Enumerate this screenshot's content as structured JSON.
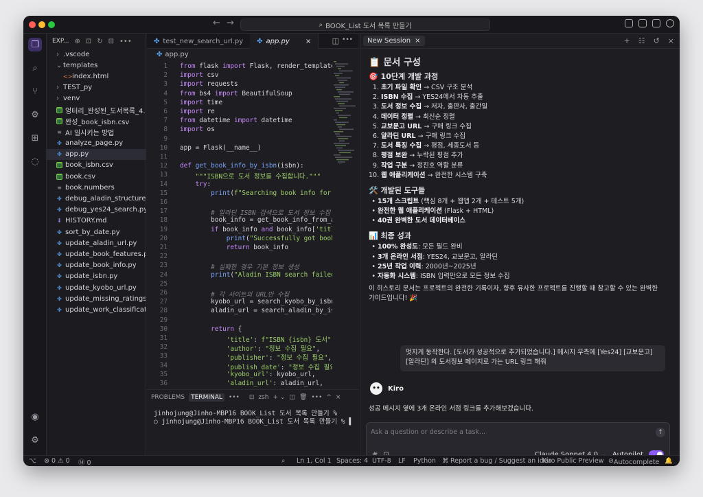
{
  "window": {
    "search": "BOOK_List 도서 목록 만들기"
  },
  "explorer": {
    "title": "EXP...",
    "items": [
      {
        "label": ".vscode",
        "type": "folder",
        "chev": "›",
        "indent": 0
      },
      {
        "label": "templates",
        "type": "folder",
        "chev": "⌄",
        "indent": 0
      },
      {
        "label": "index.html",
        "type": "html",
        "chev": "",
        "indent": 1
      },
      {
        "label": "TEST_py",
        "type": "folder",
        "chev": "›",
        "indent": 0
      },
      {
        "label": "venv",
        "type": "folder",
        "chev": "›",
        "indent": 0
      },
      {
        "label": "엉터리_완성된_도서목록_4...",
        "type": "sheet",
        "chev": "",
        "indent": 0
      },
      {
        "label": "완성_book_isbn.csv",
        "type": "sheet",
        "chev": "",
        "indent": 0
      },
      {
        "label": "AI 일시키는 방법",
        "type": "text",
        "chev": "",
        "indent": 0
      },
      {
        "label": "analyze_page.py",
        "type": "py",
        "chev": "",
        "indent": 0
      },
      {
        "label": "app.py",
        "type": "py",
        "chev": "",
        "indent": 0,
        "selected": true
      },
      {
        "label": "book_isbn.csv",
        "type": "sheet",
        "chev": "",
        "indent": 0
      },
      {
        "label": "book.csv",
        "type": "sheet",
        "chev": "",
        "indent": 0
      },
      {
        "label": "book.numbers",
        "type": "text",
        "chev": "",
        "indent": 0
      },
      {
        "label": "debug_aladin_structure...",
        "type": "py",
        "chev": "",
        "indent": 0
      },
      {
        "label": "debug_yes24_search.py",
        "type": "py",
        "chev": "",
        "indent": 0
      },
      {
        "label": "HISTORY.md",
        "type": "md",
        "chev": "",
        "indent": 0
      },
      {
        "label": "sort_by_date.py",
        "type": "py",
        "chev": "",
        "indent": 0
      },
      {
        "label": "update_aladin_url.py",
        "type": "py",
        "chev": "",
        "indent": 0
      },
      {
        "label": "update_book_features.py",
        "type": "py",
        "chev": "",
        "indent": 0
      },
      {
        "label": "update_book_info.py",
        "type": "py",
        "chev": "",
        "indent": 0
      },
      {
        "label": "update_isbn.py",
        "type": "py",
        "chev": "",
        "indent": 0
      },
      {
        "label": "update_kyobo_url.py",
        "type": "py",
        "chev": "",
        "indent": 0
      },
      {
        "label": "update_missing_ratings...",
        "type": "py",
        "chev": "",
        "indent": 0
      },
      {
        "label": "update_work_classificat...",
        "type": "py",
        "chev": "",
        "indent": 0
      }
    ]
  },
  "editor": {
    "tabs": [
      {
        "label": "test_new_search_url.py",
        "active": false
      },
      {
        "label": "app.py",
        "active": true
      }
    ],
    "breadcrumb": "app.py",
    "lines": [
      "<span class='kw'>from</span> flask <span class='kw'>import</span> Flask, render_template,",
      "<span class='kw'>import</span> csv",
      "<span class='kw'>import</span> requests",
      "<span class='kw'>from</span> bs4 <span class='kw'>import</span> BeautifulSoup",
      "<span class='kw'>import</span> time",
      "<span class='kw'>import</span> re",
      "<span class='kw'>from</span> datetime <span class='kw'>import</span> datetime",
      "<span class='kw'>import</span> os",
      "",
      "app = Flask(__name__)",
      "",
      "<span class='kw'>def</span> <span class='fn'>get_book_info_by_isbn</span>(isbn):",
      "    <span class='str'>\"\"\"ISBN으로 도서 정보를 수집합니다.\"\"\"</span>",
      "    <span class='kw'>try</span>:",
      "        <span class='fn'>print</span>(<span class='str'>f\"Searching book info for I</span>",
      "",
      "        <span class='cm'># 알라딘 ISBN 검색으로 도서 정보 수집</span>",
      "        book_info = get_book_info_from_al",
      "        <span class='kw'>if</span> book_info <span class='kw'>and</span> book_info[<span class='str'>'title</span>",
      "            <span class='fn'>print</span>(<span class='str'>\"Successfully got book</span>",
      "            <span class='kw'>return</span> book_info",
      "",
      "        <span class='cm'># 실패한 경우 기본 정보 생성</span>",
      "        <span class='fn'>print</span>(<span class='str'>\"Aladin ISBN search failed,</span>",
      "",
      "        <span class='cm'># 각 사이트의 URL만 수집</span>",
      "        kyobo_url = search_kyobo_by_isbn(",
      "        aladin_url = search_aladin_by_isb",
      "",
      "        <span class='kw'>return</span> {",
      "            <span class='str'>'title'</span>: <span class='str'>f\"ISBN {isbn} 도서\"</span>,",
      "            <span class='str'>'author'</span>: <span class='str'>\"정보 수집 필요\"</span>,",
      "            <span class='str'>'publisher'</span>: <span class='str'>\"정보 수집 필요\"</span>,",
      "            <span class='str'>'publish_date'</span>: <span class='str'>\"정보 수집 필요\"</span>,",
      "            <span class='str'>'kyobo_url'</span>: kyobo_url,",
      "            <span class='str'>'aladin_url'</span>: aladin_url,"
    ]
  },
  "terminal": {
    "tabs": [
      "PROBLEMS",
      "TERMINAL",
      "•••"
    ],
    "shell": "zsh",
    "lines": [
      "  jinhojung@Jinho-MBP16 BOOK_List 도서 목록 만들기 %",
      "○ jinhojung@Jinho-MBP16 BOOK_List 도서 목록 만들기 % ▌"
    ]
  },
  "chat": {
    "session": "New Session",
    "title": "📋 문서 구성",
    "sec1": "🎯 10단계 개발 과정",
    "steps": [
      {
        "b": "초기 파일 확인",
        "t": " → CSV 구조 분석"
      },
      {
        "b": "ISBN 수집",
        "t": " → YES24에서 자동 추출"
      },
      {
        "b": "도서 정보 수집",
        "t": " → 저자, 출판사, 출간일"
      },
      {
        "b": "데이터 정렬",
        "t": " → 최신순 정렬"
      },
      {
        "b": "교보문고 URL",
        "t": " → 구매 링크 수집"
      },
      {
        "b": "알라딘 URL",
        "t": " → 구매 링크 수집"
      },
      {
        "b": "도서 특징 수집",
        "t": " → 평점, 세종도서 등"
      },
      {
        "b": "평점 보완",
        "t": " → 누락된 평점 추가"
      },
      {
        "b": "작업 구분",
        "t": " → 정진호 역할 분류"
      },
      {
        "b": "웹 애플리케이션",
        "t": " → 완전한 시스템 구축"
      }
    ],
    "sec2": "🛠️ 개발된 도구들",
    "tools": [
      {
        "b": "15개 스크립트",
        "t": " (핵심 8개 + 웹앱 2개 + 테스트 5개)"
      },
      {
        "b": "완전한 웹 애플리케이션",
        "t": " (Flask + HTML)"
      },
      {
        "b": "40권 완벽한 도서 데이터베이스",
        "t": ""
      }
    ],
    "sec3": "📊 최종 성과",
    "results": [
      {
        "b": "100% 완성도",
        "t": ": 모든 필드 완비"
      },
      {
        "b": "3개 온라인 서점",
        "t": ": YES24, 교보문고, 알라딘"
      },
      {
        "b": "25년 작업 이력",
        "t": ": 2000년~2025년"
      },
      {
        "b": "자동화 시스템",
        "t": ": ISBN 입력만으로 모든 정보 수집"
      }
    ],
    "summary": "이 히스토리 문서는 프로젝트의 완전한 기록이자, 향후 유사한 프로젝트를 진행할 때 참고할 수 있는 완벽한 가이드입니다! 🎉",
    "user_msg": "멋지게 동작한다.  [도서가 성공적으로 추가되었습니다.] 메시지 우측에 [Yes24] [교보문고] [알라딘] 의 도서정보 페이지로 가는 URL 링크 해줘",
    "agent": "Kiro",
    "reply": "성공 메시지 옆에 3개 온라인 서점 링크를 추가해보겠습니다.",
    "placeholder": "Ask a question or describe a task...",
    "model": "Claude Sonnet 4.0 ⌄",
    "autopilot": "Autopilot"
  },
  "status": {
    "problems": "⊗ 0 ⚠ 0",
    "ports": "⑭ 0",
    "pos": "Ln 1, Col 1",
    "spaces": "Spaces: 4",
    "enc": "UTF-8",
    "eol": "LF",
    "lang": "Python",
    "bug": "Report a bug / Suggest an idea",
    "preview": "Kiro Public Preview",
    "auto": "Autocomplete"
  }
}
